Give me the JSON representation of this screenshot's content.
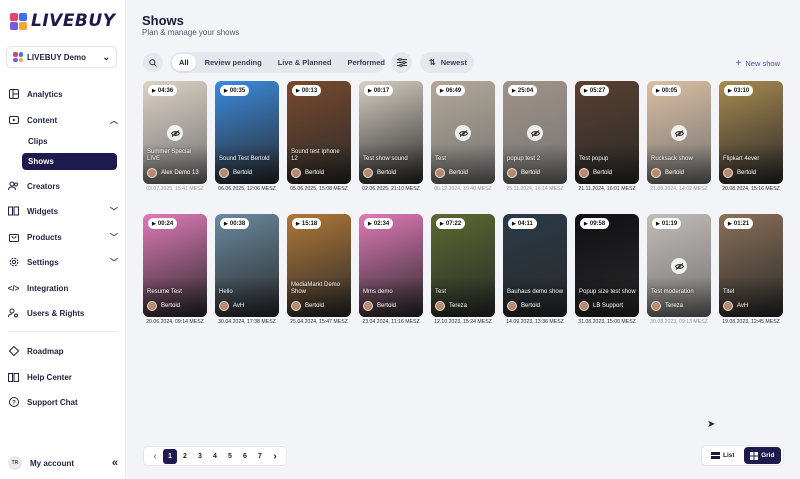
{
  "brand": {
    "name": "LIVEBUY",
    "colors": [
      "#e4426b",
      "#3f6ff0",
      "#7a5ad9",
      "#f0a83e"
    ]
  },
  "workspace": {
    "name": "LIVEBUY Demo"
  },
  "nav": {
    "analytics": "Analytics",
    "content": "Content",
    "clips": "Clips",
    "shows": "Shows",
    "creators": "Creators",
    "widgets": "Widgets",
    "products": "Products",
    "settings": "Settings",
    "integration": "Integration",
    "users": "Users & Rights",
    "roadmap": "Roadmap",
    "help": "Help Center",
    "support": "Support Chat"
  },
  "account": {
    "initials": "TR",
    "label": "My account"
  },
  "header": {
    "title": "Shows",
    "subtitle": "Plan & manage your shows"
  },
  "filters": {
    "tabs": [
      "All",
      "Review pending",
      "Live & Planned",
      "Performed"
    ],
    "sort": "Newest",
    "new_show": "New show"
  },
  "shows": [
    {
      "duration": "04:36",
      "name": "Summer Special LIVE",
      "creator": "Alex Demo 13",
      "date": "03.07.2025, 15:41 MESZ",
      "hidden": true,
      "bg": "#c9b9a8"
    },
    {
      "duration": "00:35",
      "name": "Sound Test Bertold",
      "creator": "Bertold",
      "date": "06.06.2025, 12:06 MESZ",
      "hidden": false,
      "bg": "#3a8ce0"
    },
    {
      "duration": "00:13",
      "name": "Sound test Iphone 12",
      "creator": "Bertold",
      "date": "05.06.2025, 15:08 MESZ",
      "hidden": false,
      "bg": "#7a4a2e"
    },
    {
      "duration": "00:17",
      "name": "Test show sound",
      "creator": "Bertold",
      "date": "02.06.2025, 21:10 MESZ",
      "hidden": false,
      "bg": "#d6d0c4"
    },
    {
      "duration": "06:49",
      "name": "Test",
      "creator": "Bertold",
      "date": "06.12.2024, 19:40 MESZ",
      "hidden": true,
      "bg": "#8a7a60"
    },
    {
      "duration": "25:04",
      "name": "popup test 2",
      "creator": "Bertold",
      "date": "25.11.2024, 16:14 MESZ",
      "hidden": true,
      "bg": "#6e5a48"
    },
    {
      "duration": "05:27",
      "name": "Test popup",
      "creator": "Bertold",
      "date": "21.11.2024, 16:01 MESZ",
      "hidden": false,
      "bg": "#5a4030"
    },
    {
      "duration": "00:05",
      "name": "Rucksack show",
      "creator": "Bertold",
      "date": "21.08.2024, 14:02 MESZ",
      "hidden": true,
      "bg": "#c79c70"
    },
    {
      "duration": "03:10",
      "name": "Flipkart 4ever",
      "creator": "Bertold",
      "date": "20.08.2024, 15:16 MESZ",
      "hidden": false,
      "bg": "#a88a50"
    },
    {
      "duration": "00:24",
      "name": "Resume Test",
      "creator": "Bertold",
      "date": "20.06.2024, 09:14 MESZ",
      "hidden": false,
      "bg": "#e07ab8"
    },
    {
      "duration": "00:38",
      "name": "Hello",
      "creator": "AvH",
      "date": "30.04.2024, 17:38 MESZ",
      "hidden": false,
      "bg": "#6a8aa0"
    },
    {
      "duration": "15:18",
      "name": "MediaMarkt Demo Show",
      "creator": "Bertold",
      "date": "25.04.2024, 15:47 MESZ",
      "hidden": false,
      "bg": "#b07838"
    },
    {
      "duration": "02:34",
      "name": "Mms demo",
      "creator": "Bertold",
      "date": "23.04.2024, 11:16 MESZ",
      "hidden": false,
      "bg": "#e07ab8"
    },
    {
      "duration": "07:22",
      "name": "Test",
      "creator": "Tereza",
      "date": "12.10.2023, 15:24 MESZ",
      "hidden": false,
      "bg": "#5a6a30"
    },
    {
      "duration": "04:11",
      "name": "Bauhaus demo show",
      "creator": "Bertold",
      "date": "14.09.2023, 13:36 MESZ",
      "hidden": false,
      "bg": "#2a3a48"
    },
    {
      "duration": "09:58",
      "name": "Popup size test show",
      "creator": "LB Support",
      "date": "31.08.2023, 15:00 MESZ",
      "hidden": false,
      "bg": "#101014"
    },
    {
      "duration": "01:19",
      "name": "Test moderation",
      "creator": "Tereza",
      "date": "30.08.2023, 09:13 MESZ",
      "hidden": true,
      "bg": "#a09890"
    },
    {
      "duration": "01:21",
      "name": "Titel",
      "creator": "AvH",
      "date": "19.08.2023, 12:45 MESZ",
      "hidden": false,
      "bg": "#8a7058"
    }
  ],
  "pagination": {
    "pages": [
      "1",
      "2",
      "3",
      "4",
      "5",
      "6",
      "7"
    ],
    "current": "1"
  },
  "view": {
    "list": "List",
    "grid": "Grid"
  }
}
